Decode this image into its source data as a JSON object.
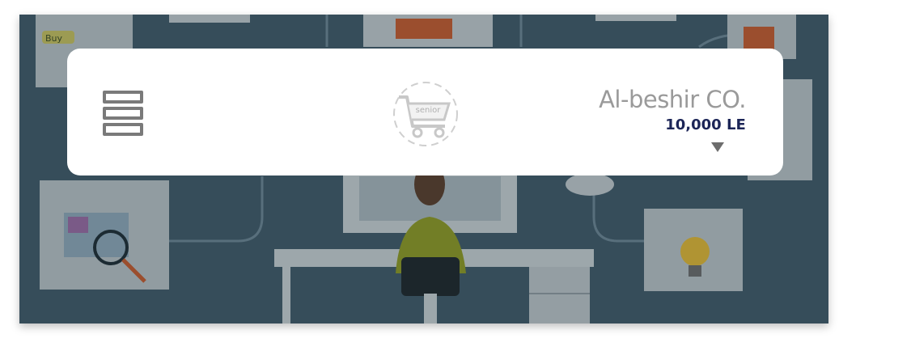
{
  "header": {
    "company_name": "Al-beshir CO.",
    "balance": "10,000 LE",
    "logo_text": "senior"
  },
  "background": {
    "badge_text": "Buy"
  },
  "colors": {
    "card_bg": "#ffffff",
    "hero_bg": "#3f5867",
    "balance_text": "#1c2557",
    "company_text": "#9a9a9a"
  },
  "icons": {
    "menu": "menu-icon",
    "logo": "shopping-cart-icon",
    "dropdown": "caret-down-icon"
  }
}
